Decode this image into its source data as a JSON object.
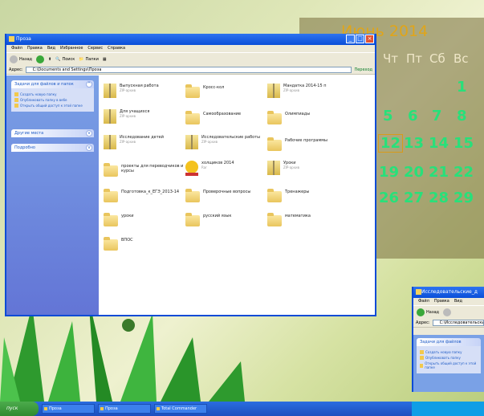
{
  "calendar": {
    "month_year": "Июнь 2014",
    "weekdays": [
      "Чт",
      "Пт",
      "Сб",
      "Вс"
    ],
    "weeks": [
      [
        "",
        "",
        "",
        "1"
      ],
      [
        "5",
        "6",
        "7",
        "8"
      ],
      [
        "12",
        "13",
        "14",
        "15"
      ],
      [
        "19",
        "20",
        "21",
        "22"
      ],
      [
        "26",
        "27",
        "28",
        "29"
      ]
    ]
  },
  "window": {
    "title": "Проза",
    "menu": [
      "Файл",
      "Правка",
      "Вид",
      "Избранное",
      "Сервис",
      "Справка"
    ],
    "toolbar": {
      "back": "Назад",
      "search": "Поиск",
      "folders": "Папки"
    },
    "address_label": "Адрес:",
    "address": "C:\\Documents and Settings\\Проза",
    "go": "Переход",
    "panels": [
      {
        "title": "Задачи для файлов и папок",
        "items": [
          "Создать новую папку",
          "Опубликовать папку в вебе",
          "Открыть общий доступ к этой папке"
        ]
      },
      {
        "title": "Другие места",
        "items": []
      },
      {
        "title": "Подробно",
        "items": []
      }
    ],
    "items": [
      {
        "name": "Выпускная работа",
        "sub": "ZIP-архив",
        "type": "zip"
      },
      {
        "name": "Кросс-кол",
        "sub": "",
        "type": "folder"
      },
      {
        "name": "Мандатка 2014-15 п",
        "sub": "ZIP-архив",
        "type": "zip"
      },
      {
        "name": "Для учащихся",
        "sub": "ZIP-архив",
        "type": "zip"
      },
      {
        "name": "Самообразование",
        "sub": "",
        "type": "folder"
      },
      {
        "name": "Олимпиады",
        "sub": "",
        "type": "folder"
      },
      {
        "name": "Исследование детей",
        "sub": "ZIP-архив",
        "type": "zip"
      },
      {
        "name": "Исследовательские работы",
        "sub": "ZIP-архив",
        "type": "zip"
      },
      {
        "name": "Рабочие программы",
        "sub": "",
        "type": "folder"
      },
      {
        "name": "проекты для переводчиков и курсы",
        "sub": "",
        "type": "folder"
      },
      {
        "name": "холщиков 2014",
        "sub": "Rar",
        "type": "smile"
      },
      {
        "name": "Уроки",
        "sub": "ZIP-архив",
        "type": "zip"
      },
      {
        "name": "Подготовка_к_ЕГЭ_2013-14",
        "sub": "",
        "type": "folder"
      },
      {
        "name": "Проверочные вопросы",
        "sub": "",
        "type": "folder"
      },
      {
        "name": "Тренажеры",
        "sub": "",
        "type": "folder"
      },
      {
        "name": "уроки",
        "sub": "",
        "type": "folder"
      },
      {
        "name": "русский язык",
        "sub": "",
        "type": "folder"
      },
      {
        "name": "математика",
        "sub": "",
        "type": "folder"
      },
      {
        "name": "ВПОС",
        "sub": "",
        "type": "folder"
      }
    ]
  },
  "window2": {
    "title": "Исследовательские_д",
    "menu": [
      "Файл",
      "Правка",
      "Вид"
    ],
    "back": "Назад",
    "address_label": "Адрес:",
    "address": "C:\\Исследовательские",
    "panel_title": "Задачи для файлов",
    "items": [
      "Создать новую папку",
      "Опубликовать папку",
      "Открыть общий доступ к этой папке"
    ]
  },
  "taskbar": {
    "start": "пуск",
    "tasks": [
      "Проза",
      "Проза",
      "Total Commander"
    ]
  }
}
